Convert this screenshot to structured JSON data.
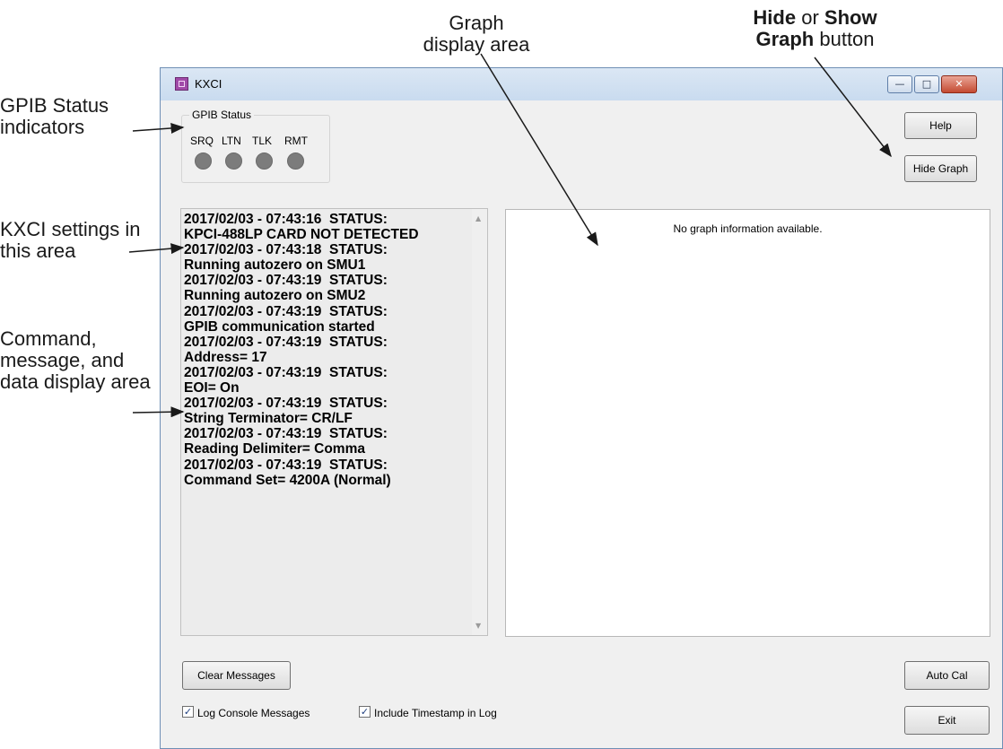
{
  "callouts": {
    "graph_area": "Graph display area",
    "hide_show_1": "Hide",
    "hide_show_2": " or ",
    "hide_show_3": "Show",
    "hide_show_4": "Graph",
    "hide_show_5": " button",
    "gpib_status": "GPIB Status indicators",
    "kxci_settings": "KXCI settings in this area",
    "command_area": "Command, message, and data display area"
  },
  "window": {
    "title": "KXCI",
    "min_glyph": "—",
    "max_glyph": "□",
    "close_glyph": "✕"
  },
  "gpib": {
    "group_title": "GPIB Status",
    "indicators": [
      "SRQ",
      "LTN",
      "TLK",
      "RMT"
    ]
  },
  "buttons": {
    "help": "Help",
    "hide_graph": "Hide Graph",
    "clear_messages": "Clear Messages",
    "auto_cal": "Auto Cal",
    "exit": "Exit"
  },
  "console": {
    "lines": [
      "2017/02/03 - 07:43:16  STATUS:",
      "KPCI-488LP CARD NOT DETECTED",
      "2017/02/03 - 07:43:18  STATUS:",
      "Running autozero on SMU1",
      "2017/02/03 - 07:43:19  STATUS:",
      "Running autozero on SMU2",
      "2017/02/03 - 07:43:19  STATUS:",
      "GPIB communication started",
      "2017/02/03 - 07:43:19  STATUS:",
      "Address= 17",
      "2017/02/03 - 07:43:19  STATUS:",
      "EOI= On",
      "2017/02/03 - 07:43:19  STATUS:",
      "String Terminator= CR/LF",
      "2017/02/03 - 07:43:19  STATUS:",
      "Reading Delimiter= Comma",
      "2017/02/03 - 07:43:19  STATUS:",
      "Command Set= 4200A (Normal)"
    ]
  },
  "graph": {
    "message": "No graph information available."
  },
  "options": {
    "log_console": {
      "label": "Log Console Messages",
      "checked": true
    },
    "include_timestamp": {
      "label": "Include Timestamp in Log",
      "checked": true
    }
  },
  "colors": {
    "led_off": "#7c7c7c",
    "window_bg": "#f0f0f0",
    "title_bar": "#c9dbef"
  },
  "icons": {
    "app": "kxci-app-icon",
    "scroll_up": "scroll-up-arrow",
    "scroll_down": "scroll-down-arrow"
  }
}
